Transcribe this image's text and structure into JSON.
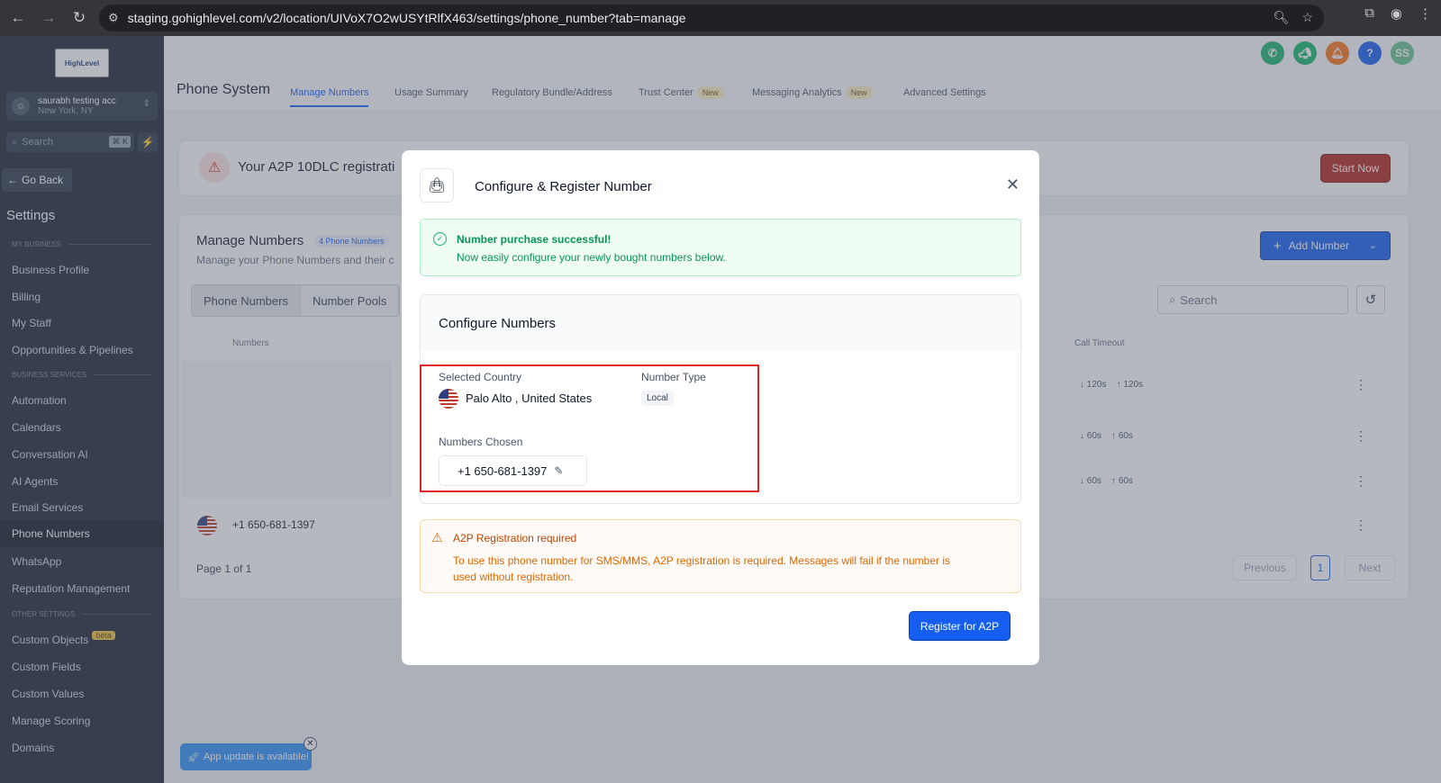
{
  "browser": {
    "url": "staging.gohighlevel.com/v2/location/UIVoX7O2wUSYtRlfX463/settings/phone_number?tab=manage"
  },
  "sidebar": {
    "logo": "HighLevel",
    "account_name": "saurabh testing acc",
    "account_location": "New York, NY",
    "search_placeholder": "Search",
    "search_shortcut": "⌘ K",
    "go_back": "Go Back",
    "settings_title": "Settings",
    "sections": {
      "my_business": "MY BUSINESS",
      "business_services": "BUSINESS SERVICES",
      "other_settings": "OTHER SETTINGS"
    },
    "items_my_business": [
      "Business Profile",
      "Billing",
      "My Staff",
      "Opportunities & Pipelines"
    ],
    "items_business_services": [
      "Automation",
      "Calendars",
      "Conversation AI",
      "AI Agents",
      "Email Services",
      "Phone Numbers",
      "WhatsApp",
      "Reputation Management"
    ],
    "items_other_settings": [
      "Custom Objects",
      "Custom Fields",
      "Custom Values",
      "Manage Scoring",
      "Domains"
    ],
    "beta_badge": "beta",
    "active_item": "Phone Numbers"
  },
  "header": {
    "avatar_initials": "SS"
  },
  "phone_system": {
    "title": "Phone System",
    "tabs": [
      {
        "label": "Manage Numbers",
        "active": true
      },
      {
        "label": "Usage Summary"
      },
      {
        "label": "Regulatory Bundle/Address"
      },
      {
        "label": "Trust Center",
        "badge": "New"
      },
      {
        "label": "Messaging Analytics",
        "badge": "New"
      },
      {
        "label": "Advanced Settings"
      }
    ]
  },
  "banner": {
    "text": "Your A2P 10DLC registrati",
    "button": "Start Now"
  },
  "manage_numbers": {
    "title": "Manage Numbers",
    "count_badge": "4 Phone Numbers",
    "subtitle": "Manage your Phone Numbers and their c",
    "add_button": "Add Number",
    "segments": [
      "Phone Numbers",
      "Number Pools"
    ],
    "search_placeholder": "Search",
    "col_numbers": "Numbers",
    "col_call_timeout": "Call Timeout",
    "rows": [
      {
        "in": "120s",
        "out": "120s"
      },
      {
        "in": "60s",
        "out": "60s"
      },
      {
        "in": "60s",
        "out": "60s"
      },
      {
        "number": "+1 650-681-1397"
      }
    ],
    "page_of": "Page 1 of 1",
    "pagination": {
      "previous": "Previous",
      "current": "1",
      "next": "Next"
    }
  },
  "modal": {
    "title": "Configure & Register Number",
    "success_title": "Number purchase successful!",
    "success_text": "Now easily configure your newly bought numbers below.",
    "configure_title": "Configure Numbers",
    "selected_country_label": "Selected Country",
    "selected_country_value": "Palo Alto , United States",
    "number_type_label": "Number Type",
    "number_type_value": "Local",
    "numbers_chosen_label": "Numbers Chosen",
    "numbers_chosen_value": "+1 650-681-1397",
    "warning_title": "A2P Registration required",
    "warning_text": "To use this phone number for SMS/MMS, A2P registration is required. Messages will fail if the number is used without registration.",
    "register_button": "Register for A2P"
  },
  "toast": {
    "text": "App update is available!"
  }
}
